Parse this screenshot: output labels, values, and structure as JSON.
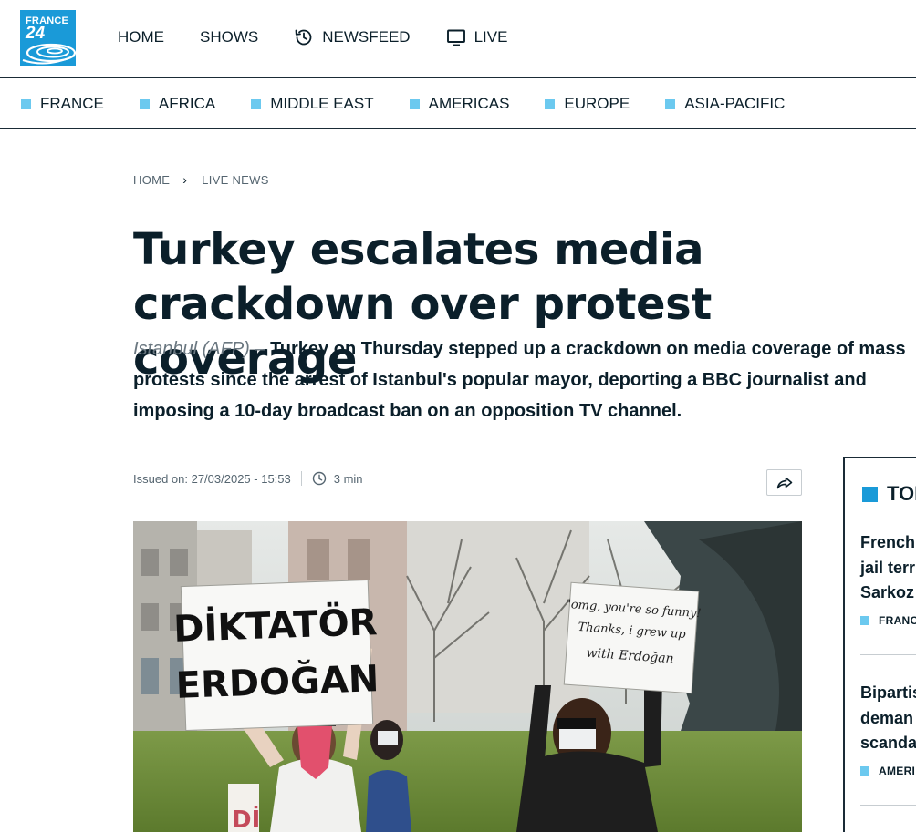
{
  "brand": {
    "line1": "FRANCE",
    "line2": "24",
    "color": "#1a9ad8"
  },
  "topnav": [
    {
      "label": "HOME",
      "icon": ""
    },
    {
      "label": "SHOWS",
      "icon": ""
    },
    {
      "label": "NEWSFEED",
      "icon": "history-icon"
    },
    {
      "label": "LIVE",
      "icon": "monitor-icon"
    }
  ],
  "regions": [
    "FRANCE",
    "AFRICA",
    "MIDDLE EAST",
    "AMERICAS",
    "EUROPE",
    "ASIA-PACIFIC"
  ],
  "breadcrumb": {
    "home": "HOME",
    "current": "LIVE NEWS"
  },
  "article": {
    "headline": "Turkey escalates media crackdown over protest coverage",
    "dateline": "Istanbul (AFP) –",
    "lede": "Turkey on Thursday stepped up a crackdown on media coverage of mass protests since the arrest of Istanbul's popular mayor, deporting a BBC journalist and imposing a 10-day broadcast ban on an opposition TV channel.",
    "issued": "Issued on: 27/03/2025 - 15:53",
    "read_time": "3 min",
    "photo": {
      "sign_left_line1": "DİKTATÖR",
      "sign_left_line2": "ERDOĞAN",
      "sign_right_line1": "\"omg, you're so funny!",
      "sign_right_line2": "Thanks, i grew up",
      "sign_right_line3": "with Erdoğan",
      "sign_bottom": "Dİ"
    }
  },
  "sidebar": {
    "title": "TOP",
    "stories": [
      {
        "lines": [
          "French",
          "jail terr",
          "Sarkoz"
        ],
        "tag": "FRANC"
      },
      {
        "lines": [
          "Bipartis",
          "deman",
          "scanda"
        ],
        "tag": "AMERI"
      }
    ]
  },
  "colors": {
    "accent": "#1a9ad8",
    "region_marker": "#6cc9ef",
    "text": "#0b1f2a"
  }
}
